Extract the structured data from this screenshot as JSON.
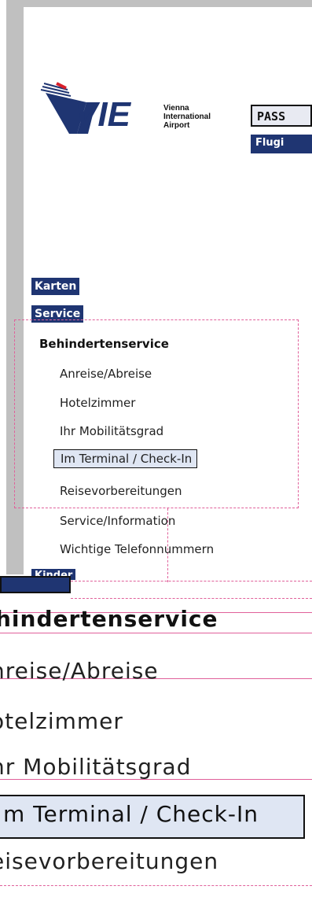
{
  "logo": {
    "brand": "VIE",
    "line1": "Vienna",
    "line2": "International",
    "line3": "Airport"
  },
  "tabs": {
    "passagiere": "PASS",
    "flug": "Flugi"
  },
  "nav": {
    "karten": "Karten",
    "service": "Service",
    "kinder": "Kinder"
  },
  "menu": {
    "heading": "Behindertenservice",
    "items": [
      "Anreise/Abreise",
      "Hotelzimmer",
      "Ihr Mobilitätsgrad",
      "Im Terminal / Check-In",
      "Reisevorbereitungen",
      "Service/Information",
      "Wichtige Telefonnummern"
    ]
  },
  "zoom": {
    "heading": "hindertenservice",
    "items": [
      "nreise/Abreise",
      "otelzimmer",
      "hr Mobilitätsgrad",
      "m Terminal / Check-In",
      "eisevorbereitungen"
    ]
  },
  "colors": {
    "nav_bg": "#1f3572",
    "frame": "#c0c0c0",
    "guide": "#e0609a",
    "active_bg": "#dfe6f3"
  }
}
